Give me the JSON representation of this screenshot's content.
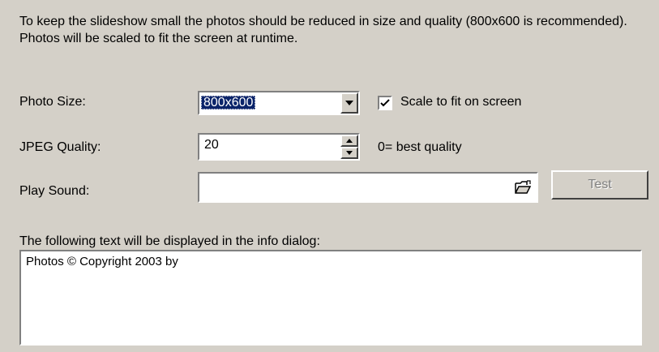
{
  "intro_text": "To keep the slideshow small the photos should be reduced in size and quality (800x600 is recommended). Photos will be scaled to fit the screen at runtime.",
  "photo_size": {
    "label": "Photo Size:",
    "value": "800x600",
    "scale_checkbox": {
      "label": "Scale to fit on screen",
      "checked": true
    }
  },
  "jpeg_quality": {
    "label": "JPEG Quality:",
    "value": "20",
    "hint": "0= best quality"
  },
  "play_sound": {
    "label": "Play Sound:",
    "value": "",
    "browse_icon": "folder-open-icon",
    "test_button": "Test"
  },
  "info": {
    "label": "The following text will be displayed in the info dialog:",
    "text": "Photos © Copyright 2003 by"
  }
}
